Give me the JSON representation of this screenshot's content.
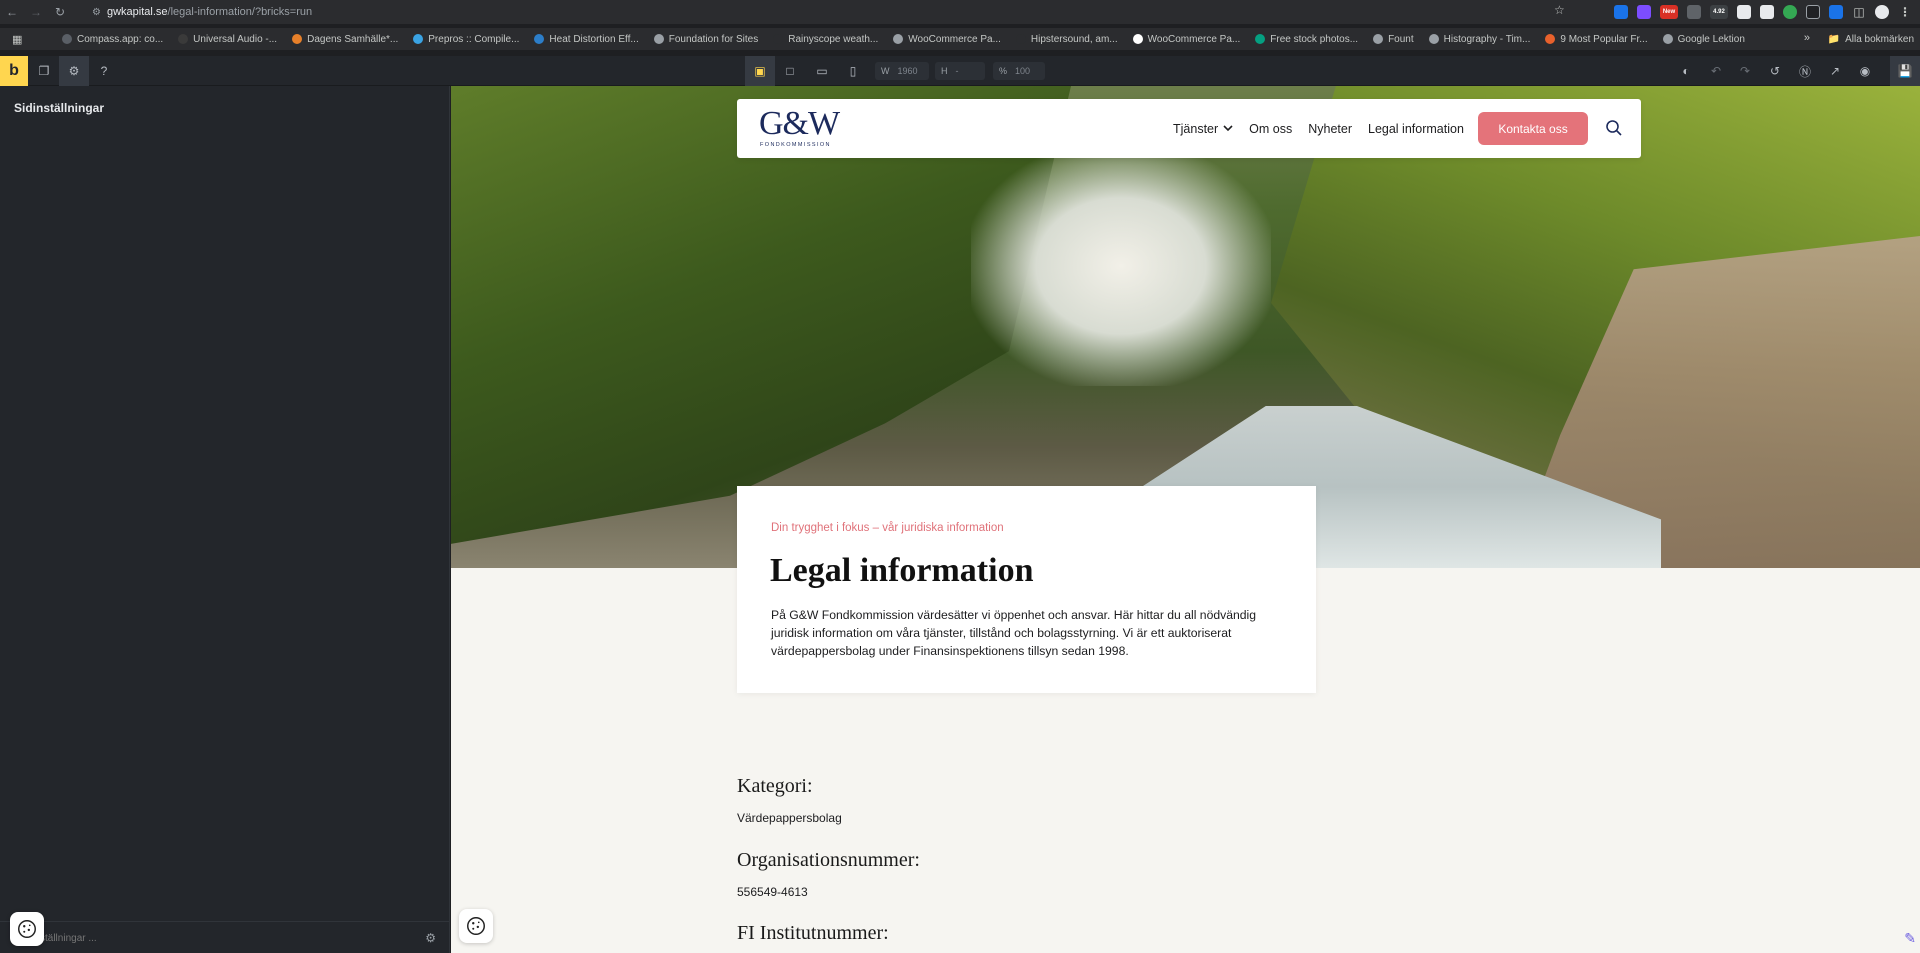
{
  "browser": {
    "url_host": "gwkapital.se",
    "url_path": "/legal-information/?bricks=run",
    "ext_badges": {
      "new": "New",
      "price": "4.92"
    }
  },
  "bookmarks": [
    {
      "label": "Compass.app: co...",
      "color": "#5a5f66"
    },
    {
      "label": "Universal Audio -...",
      "color": "#3a3a3a"
    },
    {
      "label": "Dagens Samhälle*...",
      "color": "#e7802a"
    },
    {
      "label": "Prepros :: Compile...",
      "color": "#3aa3e3"
    },
    {
      "label": "Heat Distortion Eff...",
      "color": "#2c7ec9"
    },
    {
      "label": "Foundation for Sites",
      "color": "#9aa0a6"
    },
    {
      "label": "Rainyscope weath...",
      "color": "#2b2c2f"
    },
    {
      "label": "WooCommerce Pa...",
      "color": "#9aa0a6"
    },
    {
      "label": "Hipstersound, am...",
      "color": "#2b2c2f"
    },
    {
      "label": "WooCommerce Pa...",
      "color": "#ffffff"
    },
    {
      "label": "Free stock photos...",
      "color": "#05a081"
    },
    {
      "label": "Fount",
      "color": "#9aa0a6"
    },
    {
      "label": "Histography - Tim...",
      "color": "#9aa0a6"
    },
    {
      "label": "9 Most Popular Fr...",
      "color": "#e8612c"
    },
    {
      "label": "Google Lektion",
      "color": "#9aa0a6"
    }
  ],
  "bookmarks_all": "Alla bokmärken",
  "builder": {
    "logo": "b",
    "width_label": "W",
    "width_value": "1960",
    "height_label": "H",
    "height_value": "-",
    "zoom_label": "%",
    "zoom_value": "100"
  },
  "panel": {
    "title": "Sidinställningar",
    "search_placeholder": "ställningar ..."
  },
  "site": {
    "logo": "G&W",
    "logo_sub": "FONDKOMMISSION",
    "nav": [
      "Tjänster",
      "Om oss",
      "Nyheter",
      "Legal information"
    ],
    "cta": "Kontakta oss",
    "accent": "#e4737a",
    "brand": "#1c2a5c"
  },
  "intro": {
    "eyebrow": "Din trygghet i fokus – vår juridiska information",
    "title": "Legal information",
    "body": "På G&W Fondkommission värdesätter vi öppenhet och ansvar. Här hittar du all nödvändig juridisk information om våra tjänster, tillstånd och bolagsstyrning. Vi är ett auktoriserat värdepappersbolag under Finansinspektionens tillsyn sedan 1998."
  },
  "details": [
    {
      "heading": "Kategori:",
      "value": "Värdepappersbolag"
    },
    {
      "heading": "Organisationsnummer:",
      "value": "556549-4613"
    },
    {
      "heading": "FI Institutnummer:",
      "value": ""
    }
  ]
}
